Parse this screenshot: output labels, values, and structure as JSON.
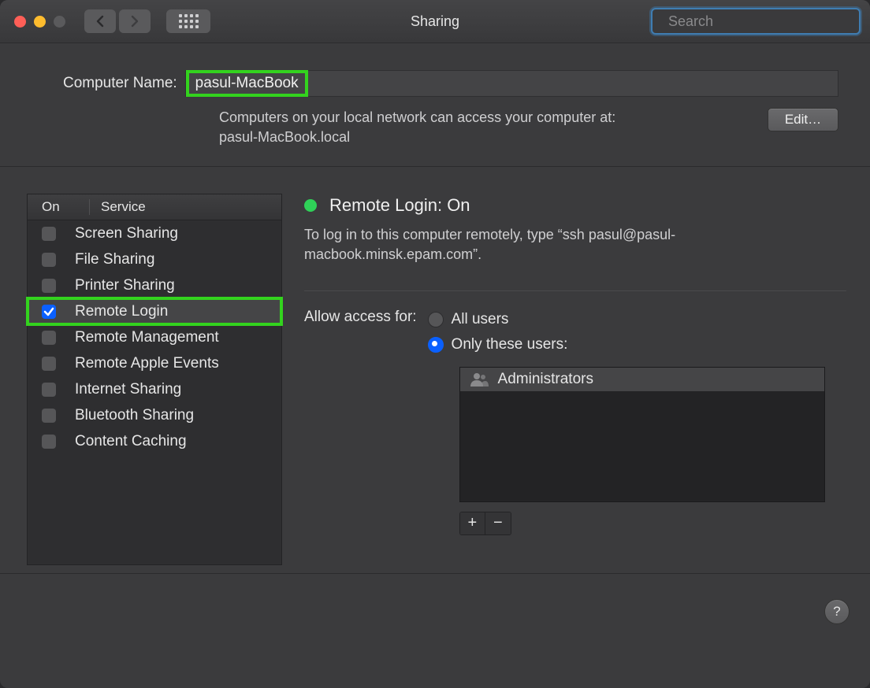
{
  "window": {
    "title": "Sharing",
    "search_placeholder": "Search"
  },
  "computer_name": {
    "label": "Computer Name:",
    "value": "pasul-MacBook",
    "hint_line1": "Computers on your local network can access your computer at:",
    "hint_line2": "pasul-MacBook.local",
    "edit_button": "Edit…"
  },
  "services_table": {
    "col_on": "On",
    "col_service": "Service",
    "rows": [
      {
        "label": "Screen Sharing",
        "on": false,
        "selected": false
      },
      {
        "label": "File Sharing",
        "on": false,
        "selected": false
      },
      {
        "label": "Printer Sharing",
        "on": false,
        "selected": false
      },
      {
        "label": "Remote Login",
        "on": true,
        "selected": true
      },
      {
        "label": "Remote Management",
        "on": false,
        "selected": false
      },
      {
        "label": "Remote Apple Events",
        "on": false,
        "selected": false
      },
      {
        "label": "Internet Sharing",
        "on": false,
        "selected": false
      },
      {
        "label": "Bluetooth Sharing",
        "on": false,
        "selected": false
      },
      {
        "label": "Content Caching",
        "on": false,
        "selected": false
      }
    ]
  },
  "detail": {
    "status_title": "Remote Login: On",
    "status_desc": "To log in to this computer remotely, type “ssh pasul@pasul-macbook.minsk.epam.com”.",
    "access_label": "Allow access for:",
    "radio_all": "All users",
    "radio_only": "Only these users:",
    "access_selected": "only",
    "users": [
      "Administrators"
    ],
    "add_symbol": "+",
    "remove_symbol": "−",
    "help_symbol": "?"
  }
}
